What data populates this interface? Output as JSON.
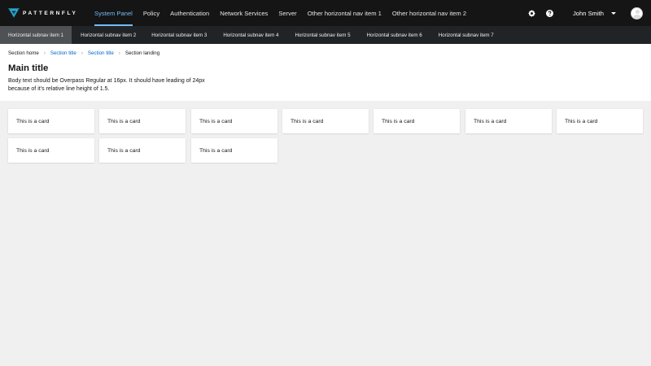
{
  "brand": {
    "name": "PATTERNFLY"
  },
  "nav": {
    "items": [
      {
        "label": "System Panel",
        "active": true
      },
      {
        "label": "Policy"
      },
      {
        "label": "Authentication"
      },
      {
        "label": "Network Services"
      },
      {
        "label": "Server"
      },
      {
        "label": "Other horizontal nav item 1"
      },
      {
        "label": "Other horizontal nav item 2"
      }
    ]
  },
  "tools": {
    "settings_icon": "gear-icon",
    "help_icon": "question-circle-icon",
    "user_name": "John Smith"
  },
  "subnav": {
    "items": [
      {
        "label": "Horizontal subnav item 1",
        "active": true
      },
      {
        "label": "Horizontal subnav item 2"
      },
      {
        "label": "Horizontal subnav item 3"
      },
      {
        "label": "Horizontal subnav item 4"
      },
      {
        "label": "Horizontal subnav item 5"
      },
      {
        "label": "Horizontal subnav item 6"
      },
      {
        "label": "Horizontal subnav item 7"
      }
    ]
  },
  "breadcrumb": {
    "items": [
      {
        "label": "Section home"
      },
      {
        "label": "Section title"
      },
      {
        "label": "Section title"
      },
      {
        "label": "Section landing"
      }
    ]
  },
  "page": {
    "title": "Main title",
    "body": "Body text should be Overpass Regular at 16px. It should have leading of 24px because of it’s relative line height of 1.5."
  },
  "cards": [
    "This is a card",
    "This is a card",
    "This is a card",
    "This is a card",
    "This is a card",
    "This is a card",
    "This is a card",
    "This is a card",
    "This is a card",
    "This is a card"
  ],
  "colors": {
    "masthead_bg": "#151515",
    "subnav_bg": "#212427",
    "accent": "#73bcf7",
    "link": "#0066cc"
  }
}
